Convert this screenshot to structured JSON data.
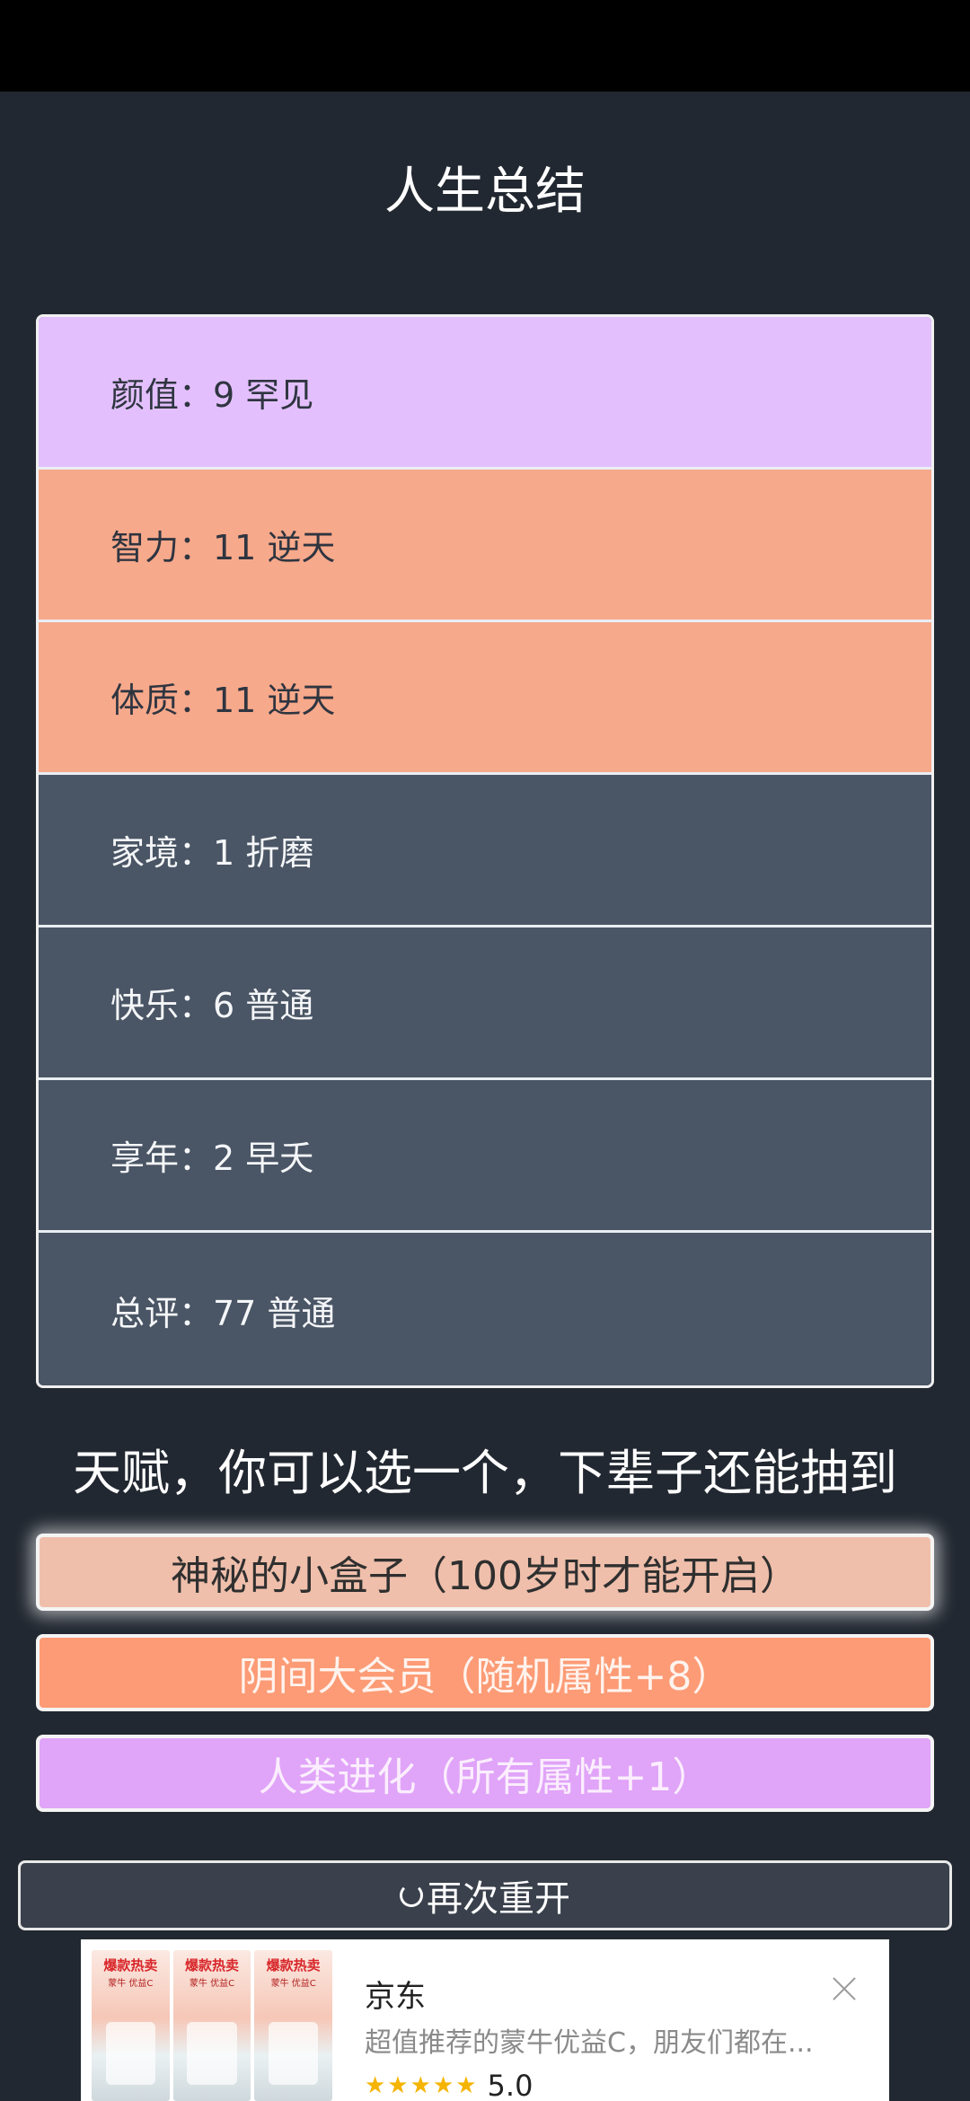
{
  "page": {
    "title": "人生总结"
  },
  "stats": [
    {
      "label": "颜值：9 罕见",
      "color": "#e3c0fd",
      "dark": false
    },
    {
      "label": "智力：11 逆天",
      "color": "#f7a98b",
      "dark": false
    },
    {
      "label": "体质：11 逆天",
      "color": "#f7a98b",
      "dark": false
    },
    {
      "label": "家境：1 折磨",
      "color": "#4a5565",
      "dark": true
    },
    {
      "label": "快乐：6 普通",
      "color": "#4a5565",
      "dark": true
    },
    {
      "label": "享年：2 早夭",
      "color": "#4a5565",
      "dark": true
    },
    {
      "label": "总评：77 普通",
      "color": "#4a5565",
      "dark": true
    }
  ],
  "talents": {
    "heading": "天赋，你可以选一个，下辈子还能抽到",
    "options": [
      {
        "label": "神秘的小盒子（100岁时才能开启）",
        "bg": "#efbfab",
        "text": "#2f2f2f",
        "selected": true
      },
      {
        "label": "阴间大会员（随机属性+8）",
        "bg": "#fc9b75",
        "text": "#fff3ee",
        "selected": false
      },
      {
        "label": "人类进化（所有属性+1）",
        "bg": "#e0a4f8",
        "text": "#fbeefe",
        "selected": false
      }
    ]
  },
  "restart": {
    "label": "再次重开",
    "icon": "refresh-icon"
  },
  "ad": {
    "brand": "京东",
    "description": "超值推荐的蒙牛优益C，朋友们都在...",
    "rating": "5.0",
    "stars": "★★★★★",
    "thumb_tag": "爆款热卖",
    "thumb_sub": "蒙牛 优益C"
  }
}
